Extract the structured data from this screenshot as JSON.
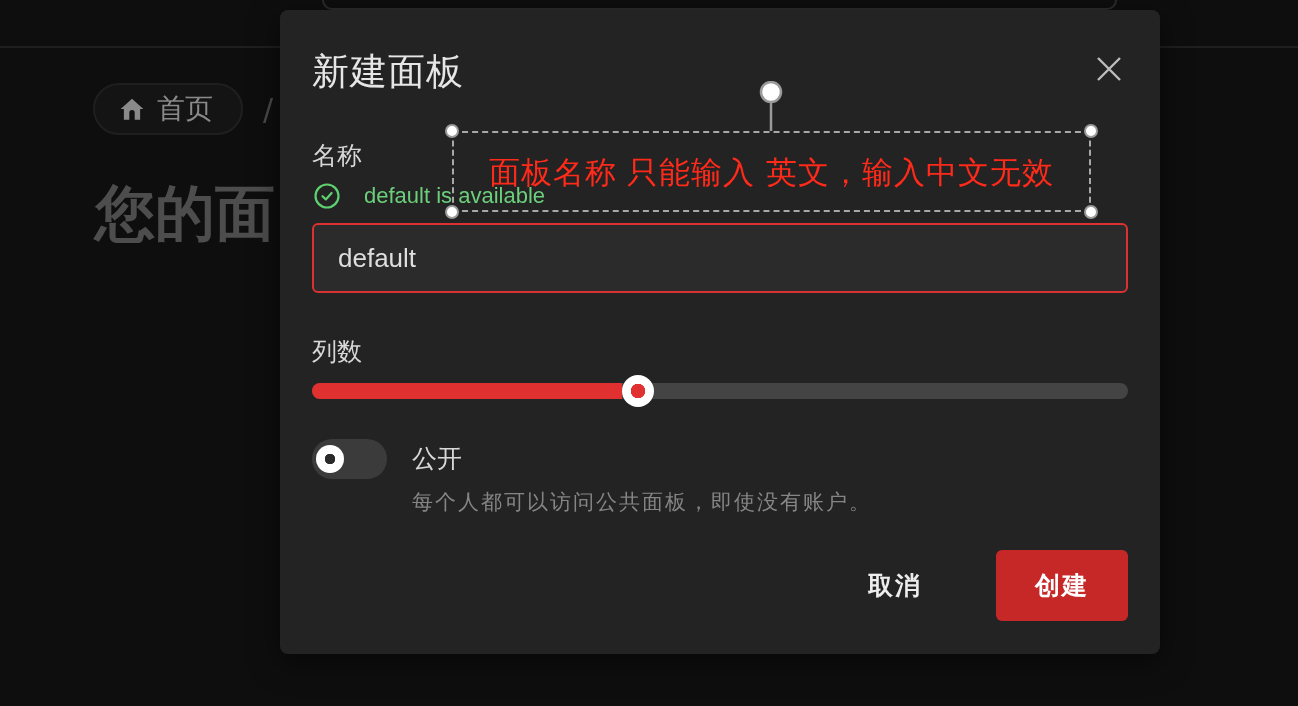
{
  "breadcrumb": {
    "items": [
      {
        "label": "首页"
      }
    ],
    "separator": "/"
  },
  "page_heading": "您的面",
  "dialog": {
    "title": "新建面板",
    "annotation": {
      "text": "面板名称 只能输入 英文，输入中文无效",
      "selected": true
    },
    "fields": [
      {
        "kind": "text",
        "label": "名称",
        "status": "default is available",
        "valid": true,
        "value": "default",
        "focused": true
      },
      {
        "kind": "slider",
        "label": "列数",
        "level": 0.4
      },
      {
        "kind": "switch",
        "label": "公开",
        "description": "每个人都可以访问公共面板，即使没有账户。",
        "on": false
      }
    ],
    "buttons": [
      {
        "label": "取消",
        "kind": "text"
      },
      {
        "label": "创建",
        "kind": "primary"
      }
    ]
  }
}
